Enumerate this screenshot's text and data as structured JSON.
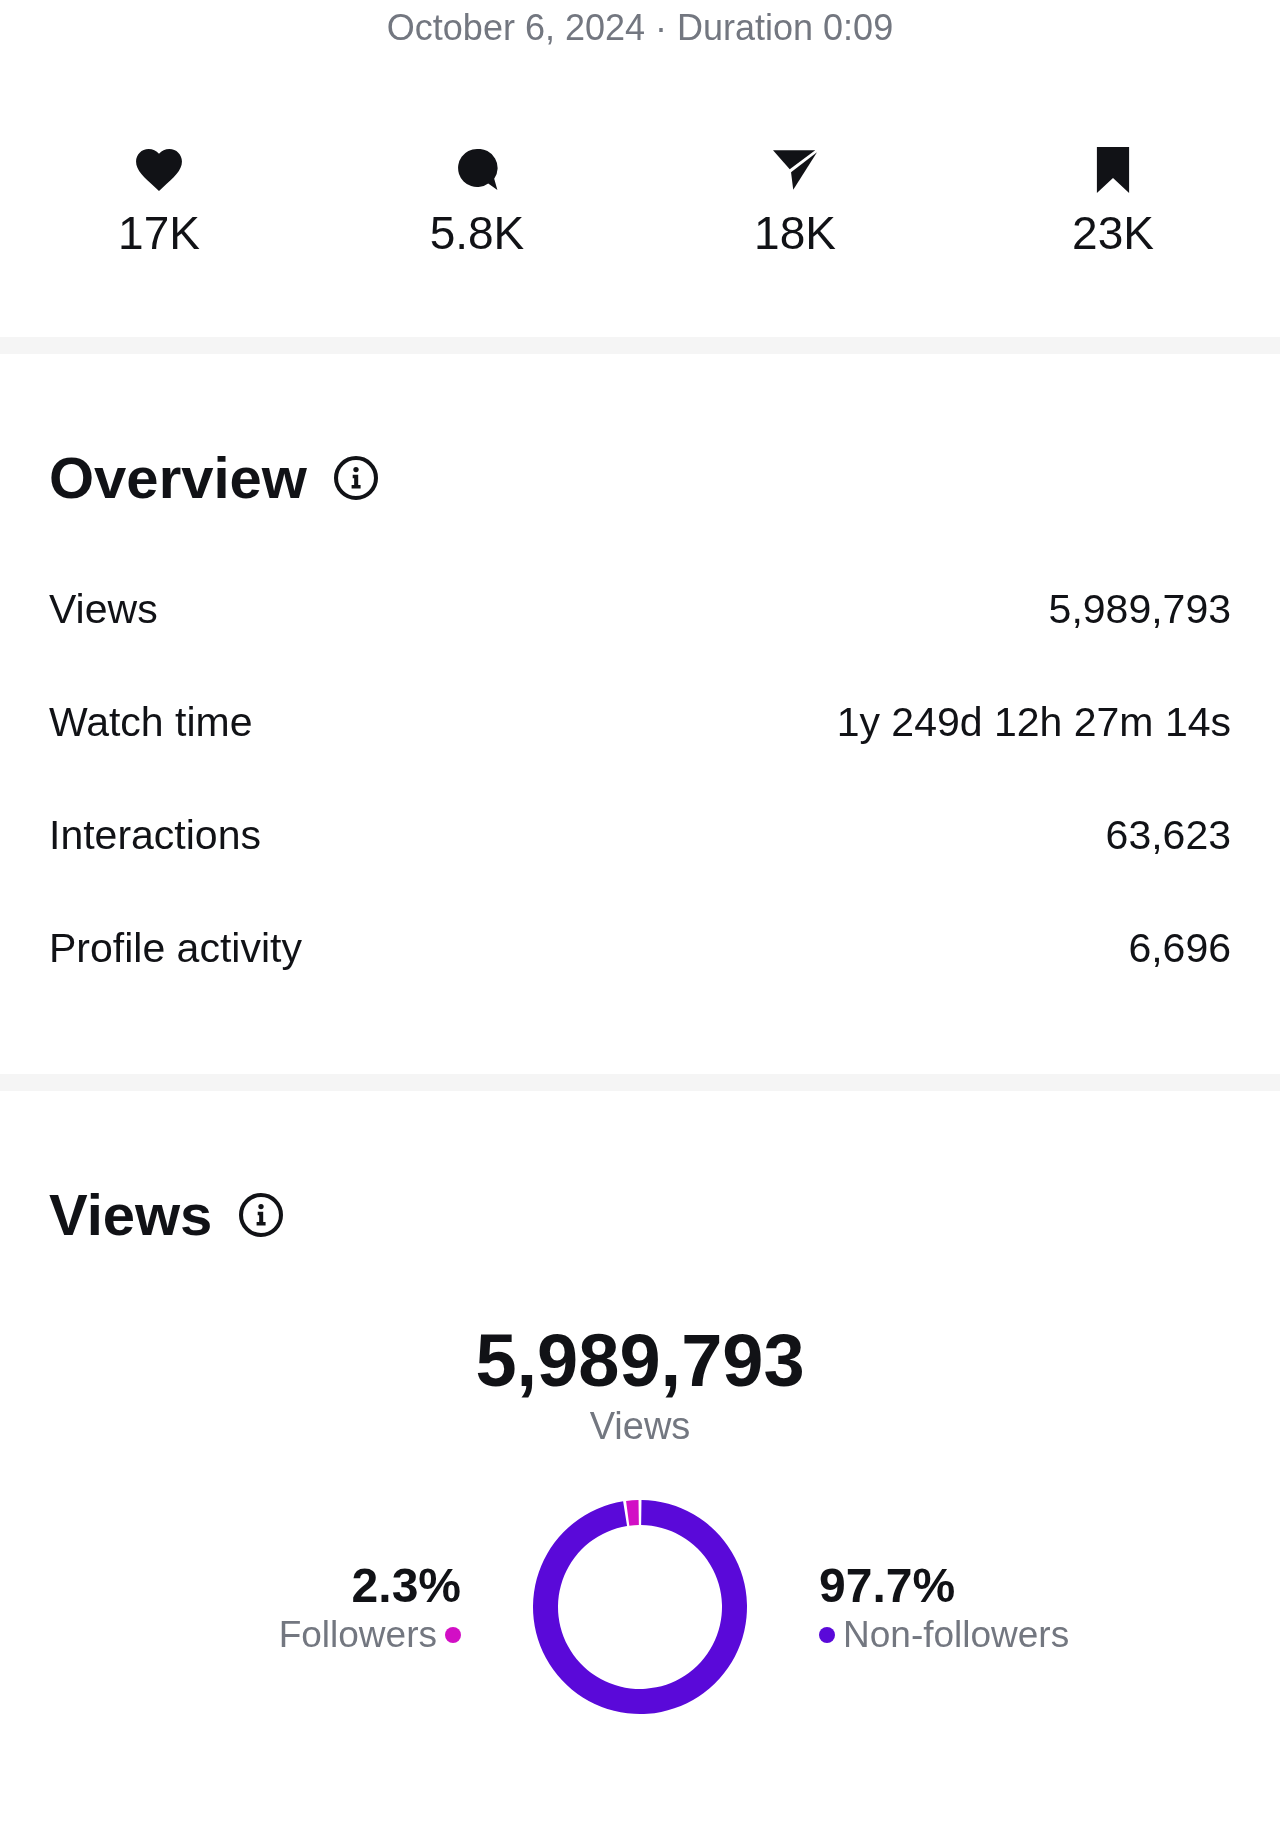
{
  "post": {
    "meta": "October 6, 2024 · Duration 0:09"
  },
  "stats": [
    {
      "kind": "likes",
      "count": "17K"
    },
    {
      "kind": "comments",
      "count": "5.8K"
    },
    {
      "kind": "shares",
      "count": "18K"
    },
    {
      "kind": "saves",
      "count": "23K"
    }
  ],
  "overview": {
    "title": "Overview",
    "rows": [
      {
        "label": "Views",
        "value": "5,989,793"
      },
      {
        "label": "Watch time",
        "value": "1y 249d 12h 27m 14s"
      },
      {
        "label": "Interactions",
        "value": "63,623"
      },
      {
        "label": "Profile activity",
        "value": "6,696"
      }
    ]
  },
  "views": {
    "title": "Views",
    "total": "5,989,793",
    "total_label": "Views",
    "legend": [
      {
        "percent": "2.3%",
        "color": "#d20fc5"
      },
      {
        "percent": "97.7%",
        "color": "#5a09d9"
      }
    ],
    "chart_data": {
      "type": "donut",
      "categories": [
        "Followers",
        "Non-followers"
      ],
      "values": [
        2.3,
        97.7
      ]
    }
  }
}
